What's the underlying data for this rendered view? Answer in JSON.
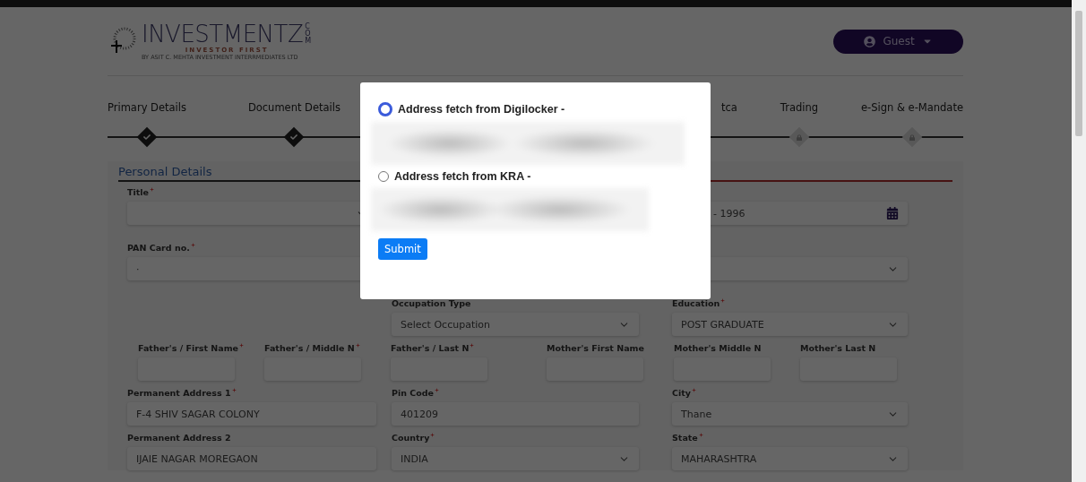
{
  "header": {
    "logo": {
      "name": "INVESTMENTZ",
      "suffix": "COM",
      "tagline": "INVESTOR FIRST",
      "byline": "BY ASIT C. MEHTA INVESTMENT INTERRMEDIATES LTD"
    },
    "user_menu": {
      "label": "Guest"
    }
  },
  "steps": {
    "left": [
      {
        "label": "Primary Details",
        "done": true
      },
      {
        "label": "Document Details",
        "done": true
      }
    ],
    "right": [
      {
        "label": "tca"
      },
      {
        "label": "Trading",
        "done": false
      },
      {
        "label": "e-Sign & e-Mandate",
        "done": false
      }
    ]
  },
  "form": {
    "section_title": "Personal Details",
    "rows": [
      {
        "left": {
          "label": "Title",
          "required": true,
          "kind": "select"
        },
        "right": {
          "kind": "date",
          "value": "- 1996"
        }
      },
      {
        "left": {
          "label": "PAN Card no.",
          "required": true,
          "kind": "text",
          "value": "·"
        },
        "right": {
          "kind": "select"
        }
      },
      {
        "middle": {
          "label": "Occupation Type",
          "required": false,
          "kind": "select",
          "value": "Select Occupation"
        },
        "right": {
          "label": "Education",
          "required": true,
          "kind": "select",
          "value": "POST GRADUATE"
        }
      },
      {
        "names": [
          {
            "label": "Father's / First Name",
            "required": true
          },
          {
            "label": "Father's / Middle N",
            "required": true
          },
          {
            "label": "Father's / Last N",
            "required": true
          },
          {
            "label": "Mother's First Name",
            "required": false
          },
          {
            "label": "Mother's Middle N",
            "required": false
          },
          {
            "label": "Mother's Last N",
            "required": false
          }
        ]
      },
      {
        "left": {
          "label": "Permanent Address 1",
          "required": true,
          "kind": "text",
          "value": "F-4 SHIV SAGAR COLONY"
        },
        "middle": {
          "label": "Pin Code",
          "required": true,
          "kind": "text",
          "value": "401209"
        },
        "right": {
          "label": "City",
          "required": true,
          "kind": "select",
          "value": "Thane"
        }
      },
      {
        "left": {
          "label": "Permanent Address 2",
          "required": false,
          "kind": "text",
          "value": "IJAIE NAGAR MOREGAON"
        },
        "middle": {
          "label": "Country",
          "required": true,
          "kind": "select",
          "value": "INDIA"
        },
        "right": {
          "label": "State",
          "required": true,
          "kind": "select",
          "value": "MAHARASHTRA"
        }
      }
    ]
  },
  "modal": {
    "options": [
      {
        "label": "Address fetch from Digilocker -",
        "selected": true
      },
      {
        "label": "Address fetch from KRA -",
        "selected": false
      }
    ],
    "submit": "Submit"
  }
}
